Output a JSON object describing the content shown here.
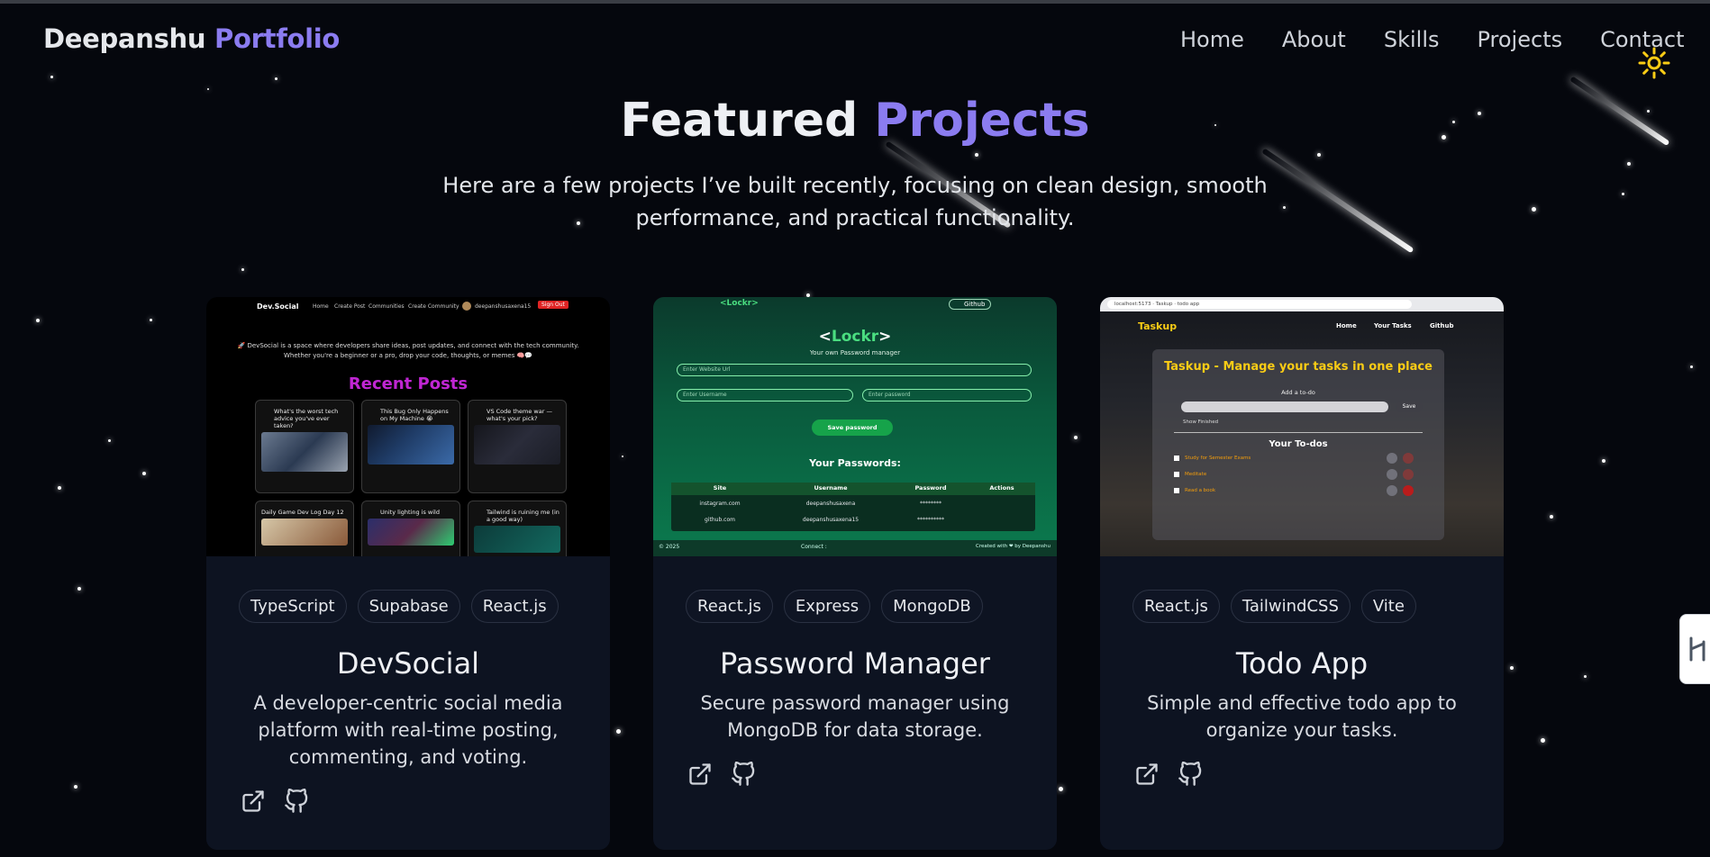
{
  "nav": {
    "brand_first": "Deepanshu",
    "brand_second": "Portfolio",
    "links": [
      "Home",
      "About",
      "Skills",
      "Projects",
      "Contact"
    ],
    "theme_toggle_icon": "sun-icon"
  },
  "hero": {
    "title_first": "Featured",
    "title_second": "Projects",
    "subtitle": "Here are a few projects I’ve built recently, focusing on clean design, smooth performance, and practical functionality."
  },
  "colors": {
    "accent": "#8b7cf0",
    "background": "#05070d",
    "card": "#0d1321"
  },
  "projects": [
    {
      "title": "DevSocial",
      "description": "A developer-centric social media platform with real-time posting, commenting, and voting.",
      "tags": [
        "TypeScript",
        "Supabase",
        "React.js"
      ],
      "preview": {
        "brand": "Dev.Social",
        "nav": [
          "Home",
          "Create Post",
          "Communities",
          "Create Community"
        ],
        "user": "deepanshusaxena15",
        "logout": "Sign Out",
        "intro_line1": "🚀 DevSocial is a space where developers share ideas, post updates, and connect with the tech community.",
        "intro_line2": "Whether you're a beginner or a pro, drop your code, thoughts, or memes 🧠💬",
        "heading": "Recent Posts",
        "posts": [
          "What's the worst tech advice you've ever taken?",
          "This Bug Only Happens on My Machine 😭",
          "VS Code theme war — what's your pick?",
          "Daily Game Dev Log Day 12",
          "Unity lighting is wild",
          "Tailwind is ruining me (in a good way)"
        ]
      }
    },
    {
      "title": "Password Manager",
      "description": "Secure password manager using MongoDB for data storage.",
      "tags": [
        "React.js",
        "Express",
        "MongoDB"
      ],
      "preview": {
        "brand": "<Lockr>",
        "github": "Github",
        "tagline": "Your own Password manager",
        "website_placeholder": "Enter Website Url",
        "username_placeholder": "Enter Username",
        "password_placeholder": "Enter password",
        "save_label": "Save password",
        "list_heading": "Your Passwords:",
        "columns": [
          "Site",
          "Username",
          "Password",
          "Actions"
        ],
        "rows": [
          [
            "instagram.com",
            "deepanshusaxena",
            "********"
          ],
          [
            "github.com",
            "deepanshusaxena15",
            "**********"
          ]
        ],
        "footer_left": "© 2025",
        "footer_mid": "Connect :",
        "footer_right": "Created with ❤ by Deepanshu"
      }
    },
    {
      "title": "Todo App",
      "description": "Simple and effective todo app to organize your tasks.",
      "tags": [
        "React.js",
        "TailwindCSS",
        "Vite"
      ],
      "preview": {
        "url": "localhost:5173  · Taskup · todo app",
        "brand": "Taskup",
        "nav": [
          "Home",
          "Your Tasks",
          "Github"
        ],
        "heading": "Taskup - Manage your tasks in one place",
        "add_label": "Add a to-do",
        "save_label": "Save",
        "show_finished": "Show Finished",
        "list_heading": "Your To-dos",
        "todos": [
          "Study for Semester Exams",
          "Meditate",
          "Read a book"
        ]
      }
    }
  ]
}
